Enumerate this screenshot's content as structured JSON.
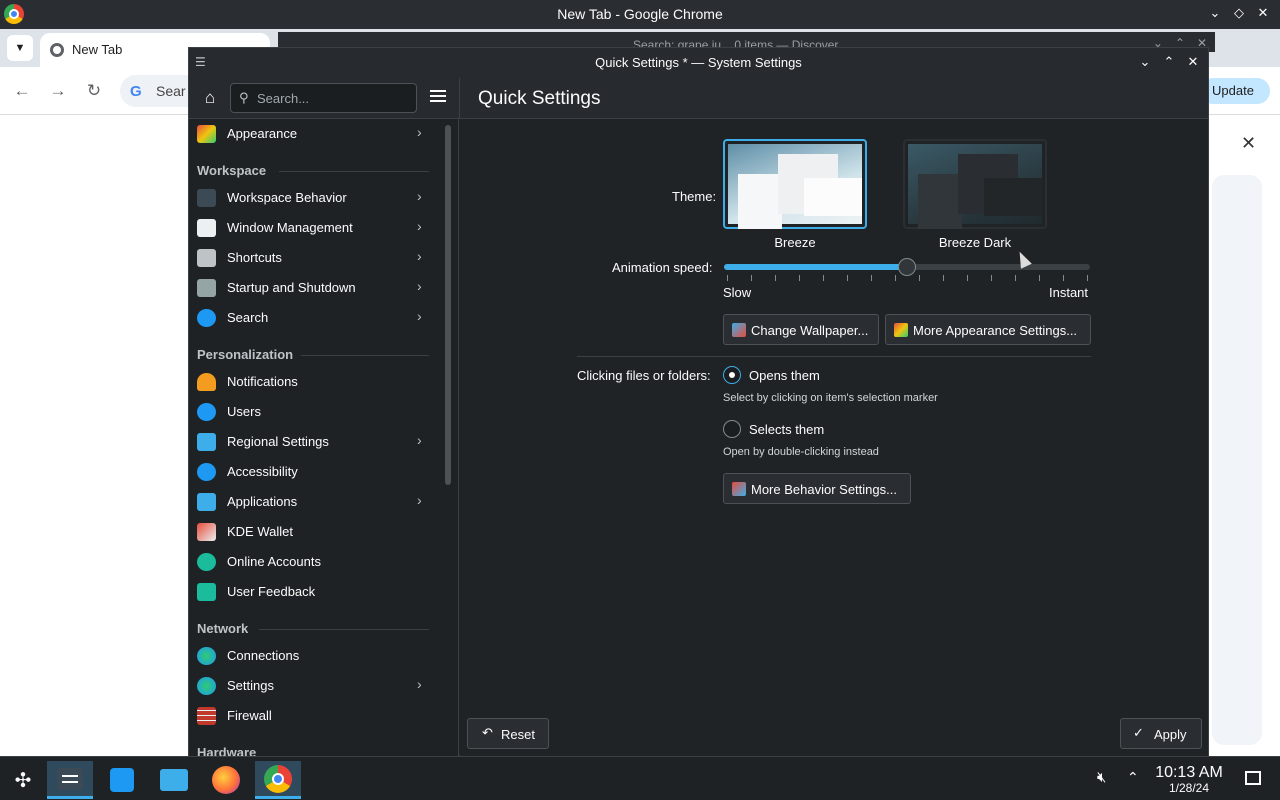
{
  "chrome": {
    "window_title": "New Tab - Google Chrome",
    "tab_label": "New Tab",
    "omnibox_text": "Sear",
    "update_label": "Update",
    "window_buttons": [
      "⌄",
      "◇",
      "✕"
    ]
  },
  "discover": {
    "window_title": "Search: grape ju... 0 items — Discover"
  },
  "settings": {
    "window_title": "Quick Settings * — System Settings",
    "search_placeholder": "Search...",
    "page_title": "Quick Settings",
    "sidebar": {
      "top_item": {
        "label": "Appearance"
      },
      "categories": {
        "workspace": "Workspace",
        "personalization": "Personalization",
        "network": "Network",
        "hardware": "Hardware"
      },
      "workspace_items": [
        {
          "label": "Workspace Behavior"
        },
        {
          "label": "Window Management"
        },
        {
          "label": "Shortcuts"
        },
        {
          "label": "Startup and Shutdown"
        },
        {
          "label": "Search"
        }
      ],
      "personalization_items": [
        {
          "label": "Notifications"
        },
        {
          "label": "Users"
        },
        {
          "label": "Regional Settings"
        },
        {
          "label": "Accessibility"
        },
        {
          "label": "Applications"
        },
        {
          "label": "KDE Wallet"
        },
        {
          "label": "Online Accounts"
        },
        {
          "label": "User Feedback"
        }
      ],
      "network_items": [
        {
          "label": "Connections"
        },
        {
          "label": "Settings"
        },
        {
          "label": "Firewall"
        }
      ]
    },
    "theme": {
      "label": "Theme:",
      "options": [
        {
          "name": "Breeze",
          "selected": true
        },
        {
          "name": "Breeze Dark",
          "selected": false
        }
      ]
    },
    "animation": {
      "label": "Animation speed:",
      "min_label": "Slow",
      "max_label": "Instant",
      "value_fraction": 0.5
    },
    "buttons": {
      "change_wallpaper": "Change Wallpaper...",
      "more_appearance": "More Appearance Settings...",
      "more_behavior": "More Behavior Settings...",
      "reset": "Reset",
      "apply": "Apply"
    },
    "clicking": {
      "label": "Clicking files or folders:",
      "option1": "Opens them",
      "option1_hint": "Select by clicking on item's selection marker",
      "option2": "Selects them",
      "option2_hint": "Open by double-clicking instead",
      "selected": "option1"
    }
  },
  "taskbar": {
    "time": "10:13 AM",
    "date": "1/28/24"
  },
  "colors": {
    "accent": "#3daee9",
    "window_bg": "#202326",
    "sidebar_bg": "#1f2225"
  }
}
